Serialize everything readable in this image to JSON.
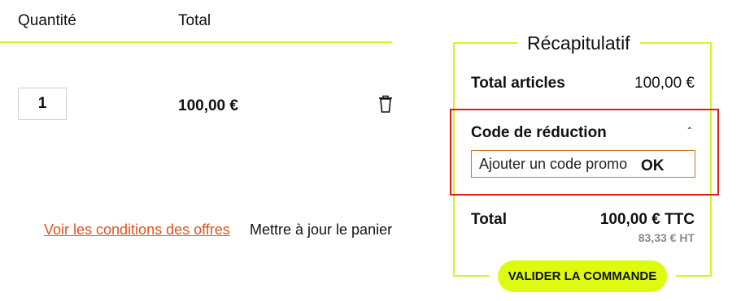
{
  "cart": {
    "columns": [
      "Quantité",
      "Total"
    ],
    "row": {
      "quantity": "1",
      "total": "100,00 €"
    },
    "offers_link": "Voir les conditions des offres",
    "update_label": "Mettre à jour le panier"
  },
  "summary": {
    "title": "Récapitulatif",
    "articles_label": "Total articles",
    "articles_value": "100,00 €",
    "promo": {
      "title": "Code de réduction",
      "placeholder": "Ajouter un code promo",
      "ok_label": "OK"
    },
    "total_label": "Total",
    "total_ttc": "100,00 € TTC",
    "total_ht": "83,33 € HT",
    "validate_label": "VALIDER LA COMMANDE"
  },
  "colors": {
    "accent": "#d7f21f",
    "button": "#ddfb0f",
    "highlight": "#e01919",
    "link": "#e0531b"
  },
  "icons": [
    "trash-icon",
    "chevron-up-icon"
  ]
}
